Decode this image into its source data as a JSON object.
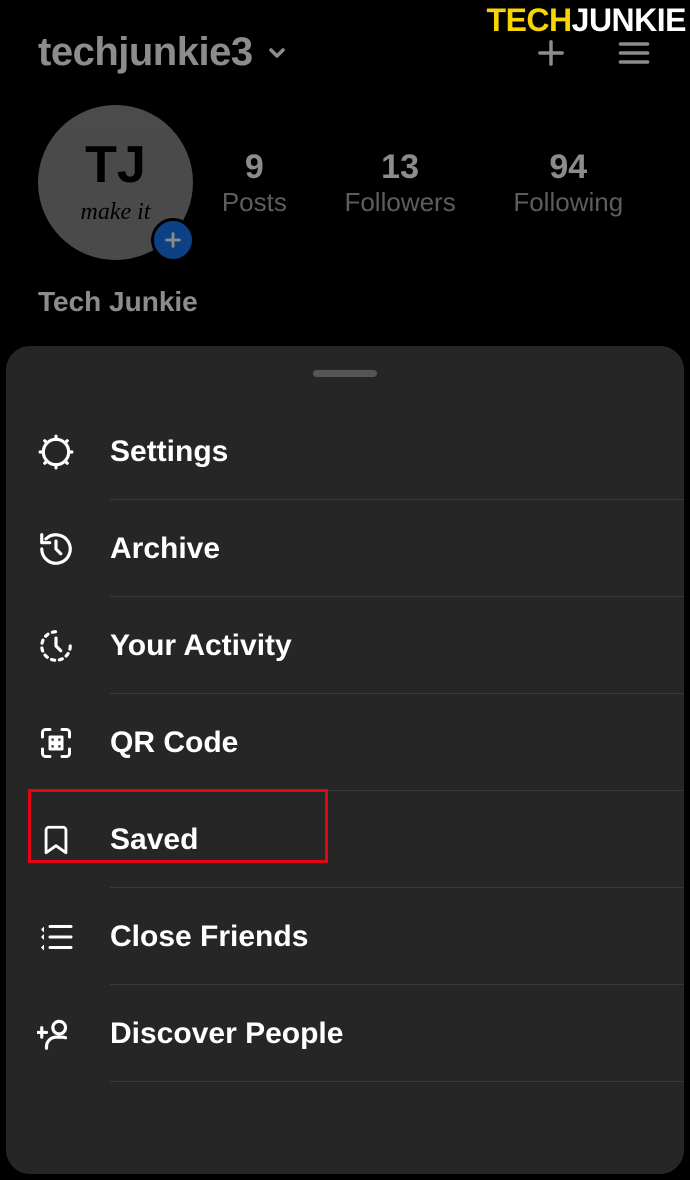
{
  "watermark": {
    "part1": "TECH",
    "part2": "JUNKIE"
  },
  "header": {
    "username": "techjunkie3"
  },
  "avatar": {
    "initials": "TJ",
    "subtext": "make it"
  },
  "stats": {
    "posts": {
      "count": "9",
      "label": "Posts"
    },
    "followers": {
      "count": "13",
      "label": "Followers"
    },
    "following": {
      "count": "94",
      "label": "Following"
    }
  },
  "displayName": "Tech Junkie",
  "menu": {
    "items": [
      {
        "label": "Settings"
      },
      {
        "label": "Archive"
      },
      {
        "label": "Your Activity"
      },
      {
        "label": "QR Code"
      },
      {
        "label": "Saved"
      },
      {
        "label": "Close Friends"
      },
      {
        "label": "Discover People"
      }
    ]
  }
}
